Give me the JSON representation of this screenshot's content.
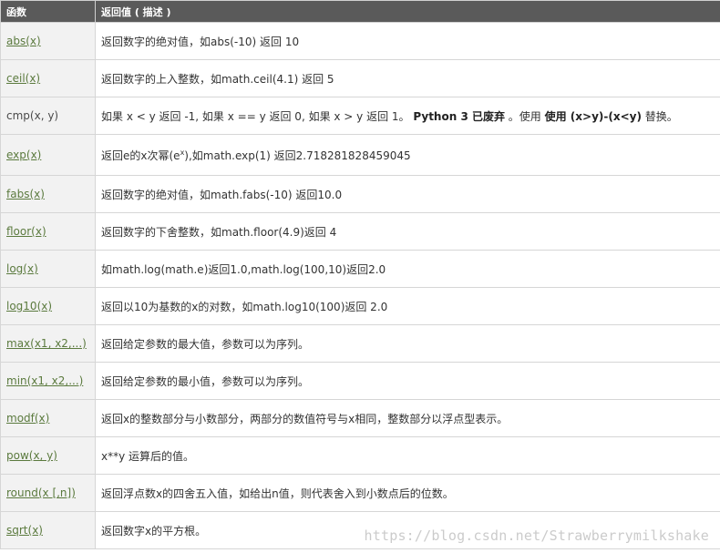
{
  "header": {
    "col1": "函数",
    "col2": "返回值 ( 描述 )"
  },
  "rows": [
    {
      "fn": "abs(x)",
      "desc": "返回数字的绝对值，如abs(-10) 返回 10"
    },
    {
      "fn": "ceil(x)",
      "desc": "返回数字的上入整数，如math.ceil(4.1) 返回 5"
    },
    {
      "fn": "cmp(x, y)",
      "desc_a": "如果 x < y 返回 -1, 如果 x == y 返回 0, 如果 x > y 返回 1。 ",
      "desc_b": "Python 3 已废弃",
      "desc_c": " 。使用 ",
      "desc_d": "使用 (x>y)-(x<y)",
      "desc_e": " 替换。"
    },
    {
      "fn": "exp(x)",
      "desc_a": "返回e的x次幂(e",
      "desc_sup": "x",
      "desc_b": "),如math.exp(1) 返回2.718281828459045"
    },
    {
      "fn": "fabs(x)",
      "desc": "返回数字的绝对值，如math.fabs(-10) 返回10.0"
    },
    {
      "fn": "floor(x)",
      "desc": "返回数字的下舍整数，如math.floor(4.9)返回 4"
    },
    {
      "fn": "log(x)",
      "desc": "如math.log(math.e)返回1.0,math.log(100,10)返回2.0"
    },
    {
      "fn": "log10(x)",
      "desc": "返回以10为基数的x的对数，如math.log10(100)返回 2.0"
    },
    {
      "fn": "max(x1, x2,...)",
      "desc": "返回给定参数的最大值，参数可以为序列。"
    },
    {
      "fn": "min(x1, x2,...)",
      "desc": "返回给定参数的最小值，参数可以为序列。"
    },
    {
      "fn": "modf(x)",
      "desc": "返回x的整数部分与小数部分，两部分的数值符号与x相同，整数部分以浮点型表示。"
    },
    {
      "fn": "pow(x, y)",
      "desc": "x**y 运算后的值。"
    },
    {
      "fn": "round(x [,n])",
      "desc": "返回浮点数x的四舍五入值，如给出n值，则代表舍入到小数点后的位数。"
    },
    {
      "fn": "sqrt(x)",
      "desc": "返回数字x的平方根。"
    }
  ],
  "watermark": "https://blog.csdn.net/Strawberrymilkshake",
  "colors": {
    "header_bg": "#5a5a5a",
    "link": "#5b7a3e",
    "fn_cell_bg": "#f2f2f2"
  }
}
